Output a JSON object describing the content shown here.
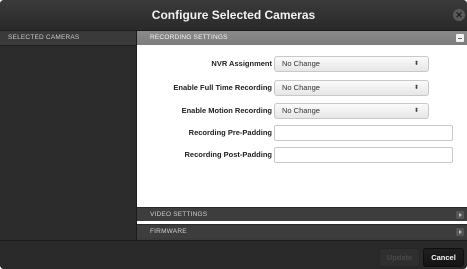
{
  "dialog": {
    "title": "Configure Selected Cameras",
    "close_icon": "close-icon"
  },
  "left_pane": {
    "header": "SELECTED CAMERAS"
  },
  "sections": {
    "recording": {
      "label": "RECORDING SETTINGS",
      "state": "expanded",
      "toggle_icon": "minus-icon"
    },
    "video": {
      "label": "VIDEO SETTINGS",
      "state": "collapsed",
      "toggle_icon": "chevron-right-icon"
    },
    "firmware": {
      "label": "FIRMWARE",
      "state": "collapsed",
      "toggle_icon": "chevron-right-icon"
    }
  },
  "recording_settings": {
    "nvr_assignment": {
      "label": "NVR Assignment",
      "value": "No Change"
    },
    "full_time_recording": {
      "label": "Enable Full Time Recording",
      "value": "No Change"
    },
    "motion_recording": {
      "label": "Enable Motion Recording",
      "value": "No Change"
    },
    "pre_padding": {
      "label": "Recording Pre-Padding",
      "value": ""
    },
    "post_padding": {
      "label": "Recording Post-Padding",
      "value": ""
    }
  },
  "footer": {
    "update_label": "Update",
    "cancel_label": "Cancel"
  },
  "colors": {
    "dialog_bg": "#2b2b2b",
    "section_header_active": "#858585",
    "panel_bg": "#ffffff",
    "button_dark": "#1a1a1a"
  }
}
